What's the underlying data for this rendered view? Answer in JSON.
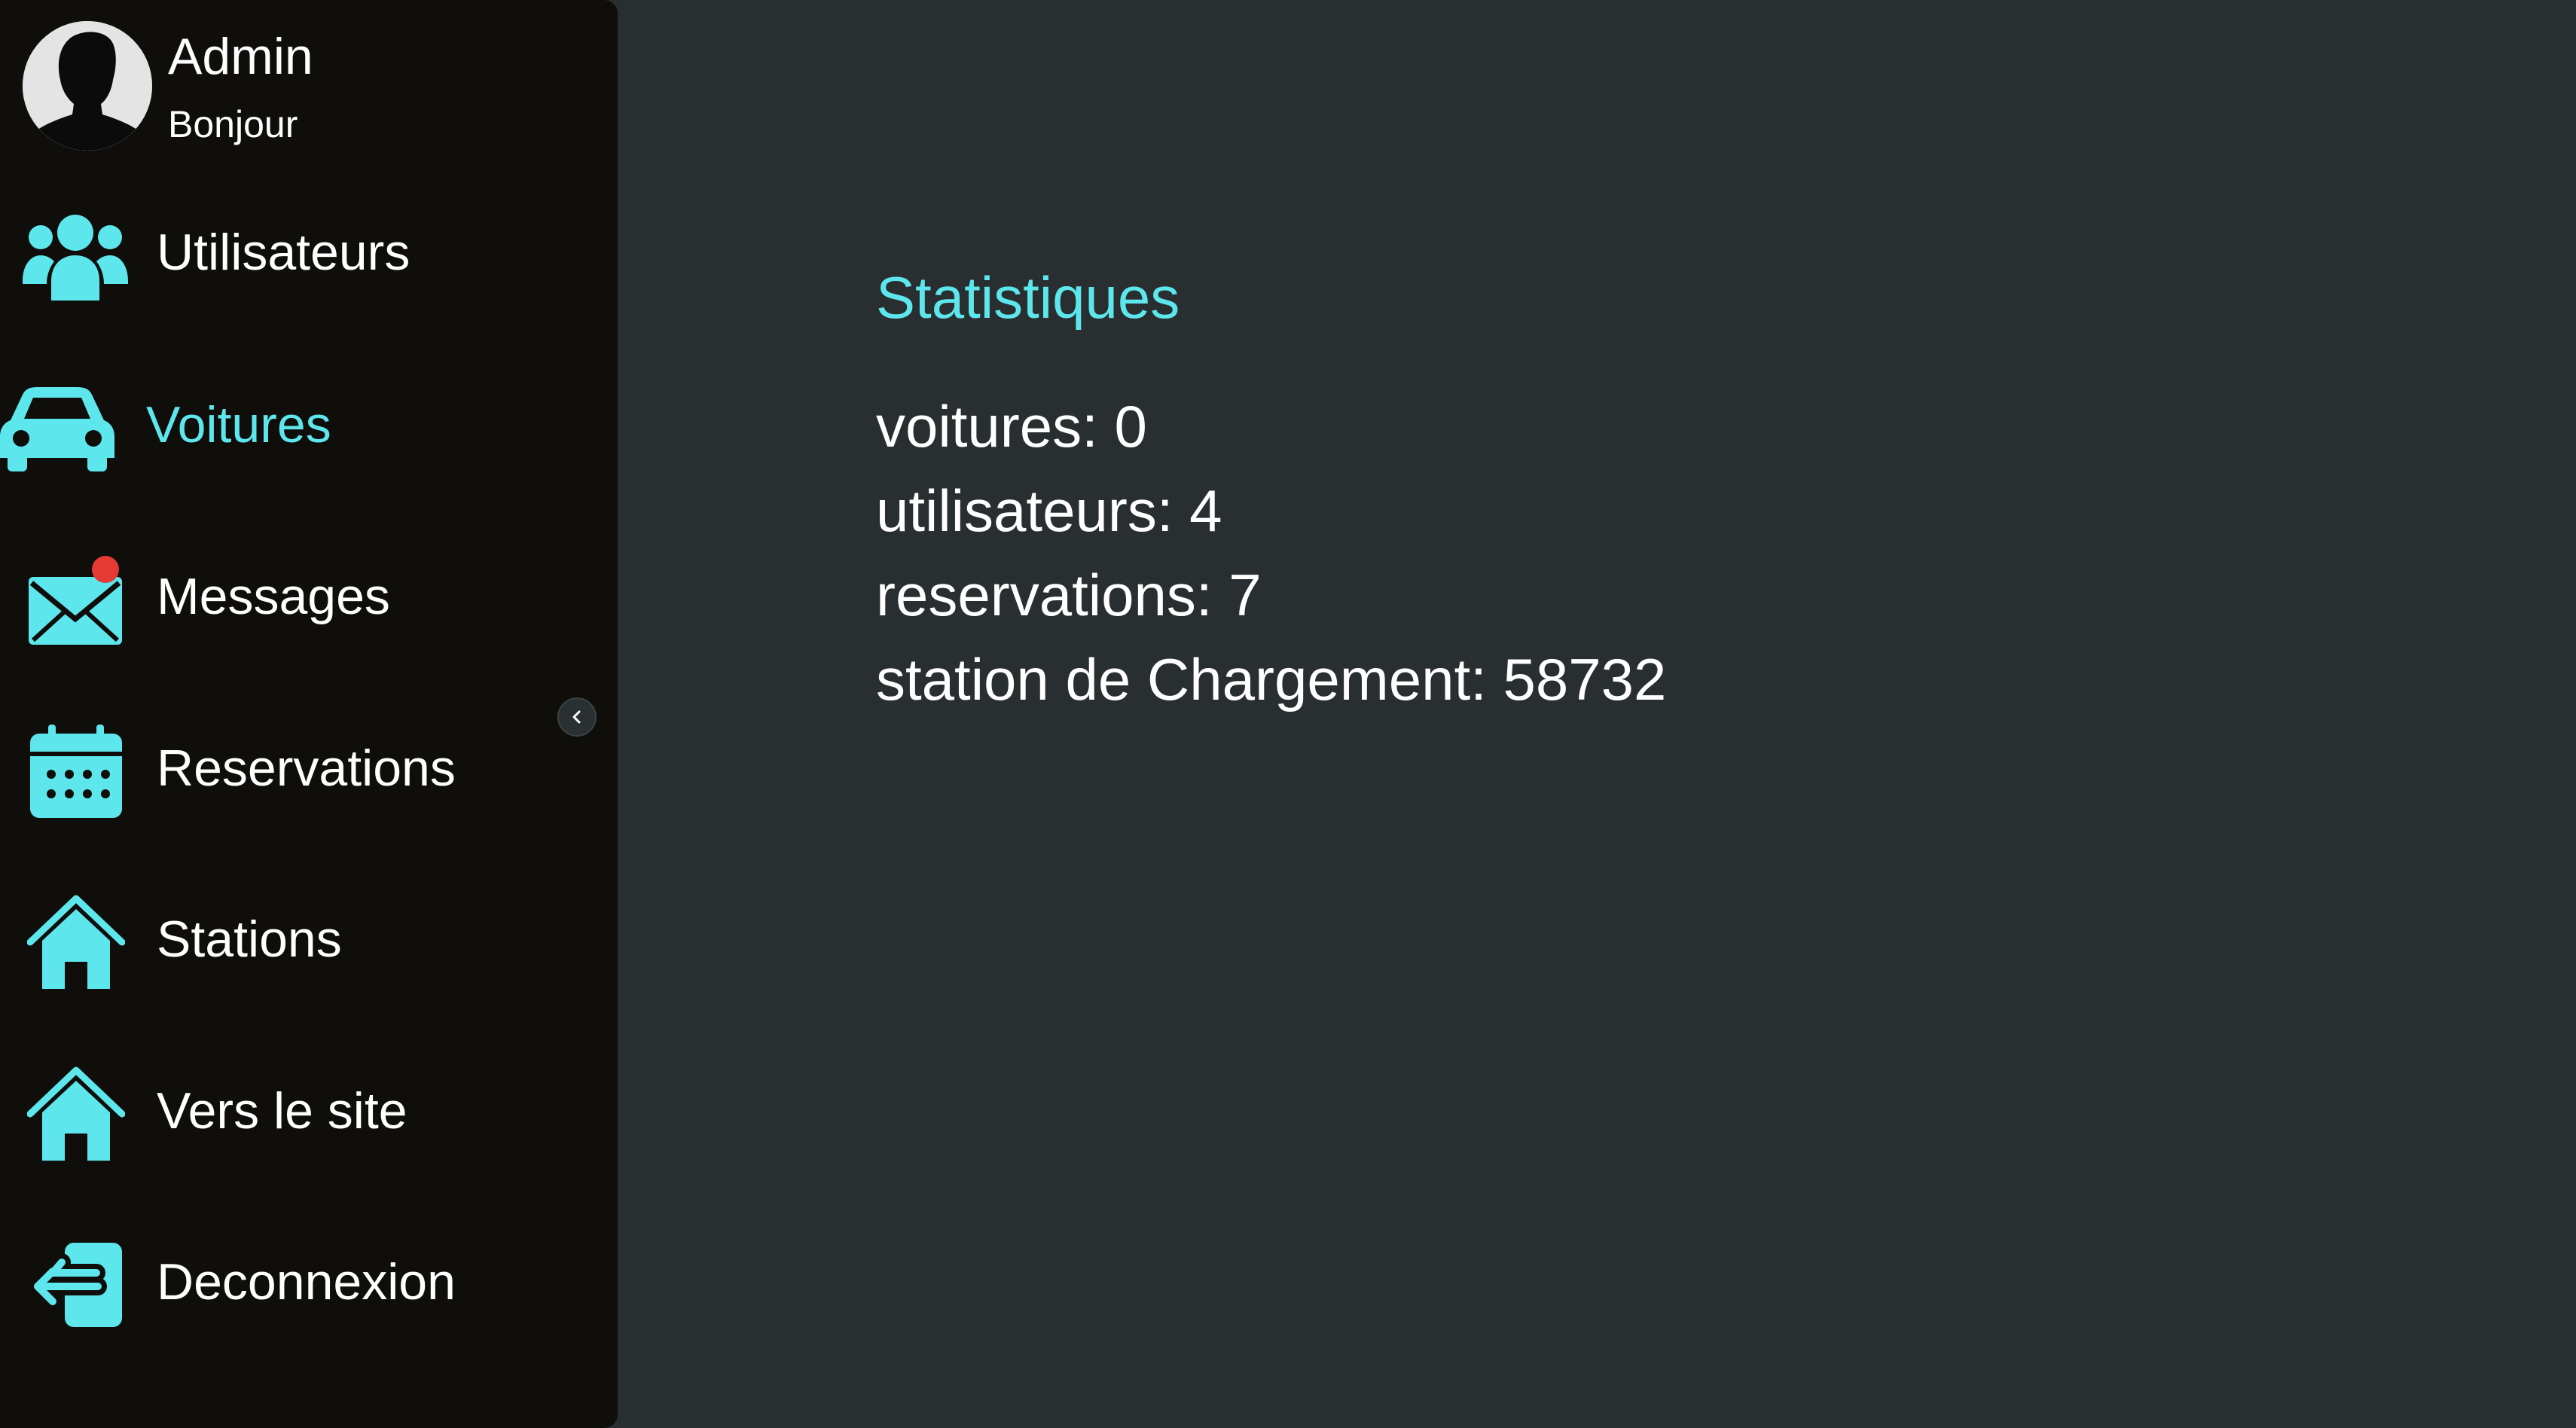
{
  "user": {
    "name": "Admin",
    "greeting": "Bonjour"
  },
  "nav": {
    "items": [
      {
        "label": "Utilisateurs",
        "icon": "users-icon"
      },
      {
        "label": "Voitures",
        "icon": "car-icon",
        "active": true
      },
      {
        "label": "Messages",
        "icon": "envelope-icon",
        "notification": true
      },
      {
        "label": "Reservations",
        "icon": "calendar-icon"
      },
      {
        "label": "Stations",
        "icon": "home-icon"
      },
      {
        "label": "Vers le site",
        "icon": "home-icon"
      },
      {
        "label": "Deconnexion",
        "icon": "logout-icon"
      }
    ]
  },
  "stats": {
    "title": "Statistiques",
    "lines": [
      "voitures: 0",
      "utilisateurs: 4",
      "reservations: 7",
      "station de Chargement: 58732"
    ]
  },
  "colors": {
    "accent": "#5de6ec",
    "background": "#292e30",
    "sidebar": "#0f0e0b",
    "notification": "#e53935"
  }
}
